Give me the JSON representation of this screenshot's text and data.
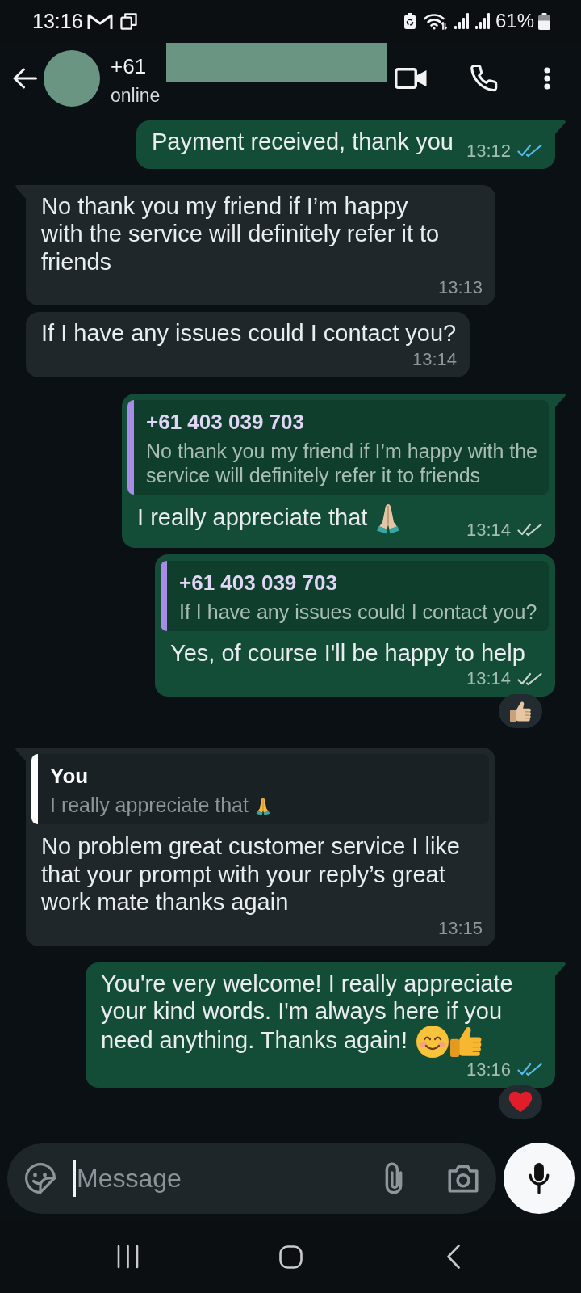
{
  "status_bar": {
    "time": "13:16",
    "battery": "61%"
  },
  "header": {
    "title": "+61",
    "subtitle": "online",
    "redacted": true
  },
  "messages": [
    {
      "kind": "outgoing",
      "tail": true,
      "text": "Payment received, thank you",
      "time": "13:12",
      "read": true
    },
    {
      "kind": "incoming",
      "tail": true,
      "text": "No thank you my friend if I’m happy\nwith the service will definitely refer it to\nfriends",
      "time": "13:13"
    },
    {
      "kind": "incoming",
      "tail": false,
      "text": "If I have any issues could I contact you?",
      "time": "13:14"
    },
    {
      "kind": "outgoing",
      "tail": true,
      "quote": {
        "author": "+61 403 039 703",
        "text": "No thank you my friend if I’m happy with the\nservice will definitely refer it to friends",
        "color": "#a78ce6"
      },
      "text": "I really appreciate that",
      "emojis": [
        {
          "kind": "folded-hands-light"
        }
      ],
      "time": "13:14",
      "read": false
    },
    {
      "kind": "outgoing",
      "tail": false,
      "quote": {
        "author": "+61 403 039 703",
        "text": "If I have any issues could I contact you?",
        "color": "#a78ce6"
      },
      "text": "Yes, of course I'll be happy to help",
      "time": "13:14",
      "read": false,
      "reaction": {
        "kind": "thumbs-up-light"
      }
    },
    {
      "kind": "incoming",
      "tail": true,
      "quote": {
        "author": "You",
        "text": "I really appreciate that",
        "emojis": [
          {
            "kind": "folded-hands"
          }
        ],
        "color": "#ffffff"
      },
      "text": "No problem great customer service I like\nthat your prompt with your reply’s great\nwork mate thanks again",
      "time": "13:15"
    },
    {
      "kind": "outgoing",
      "tail": true,
      "text": "You're very welcome! I really appreciate\nyour kind words. I'm always here if you\nneed anything. Thanks again!",
      "emojis": [
        {
          "kind": "smiling-face"
        },
        {
          "kind": "thumbs-up"
        }
      ],
      "time": "13:16",
      "read": true,
      "reaction": {
        "kind": "heart"
      }
    }
  ],
  "composer": {
    "placeholder": "Message"
  }
}
